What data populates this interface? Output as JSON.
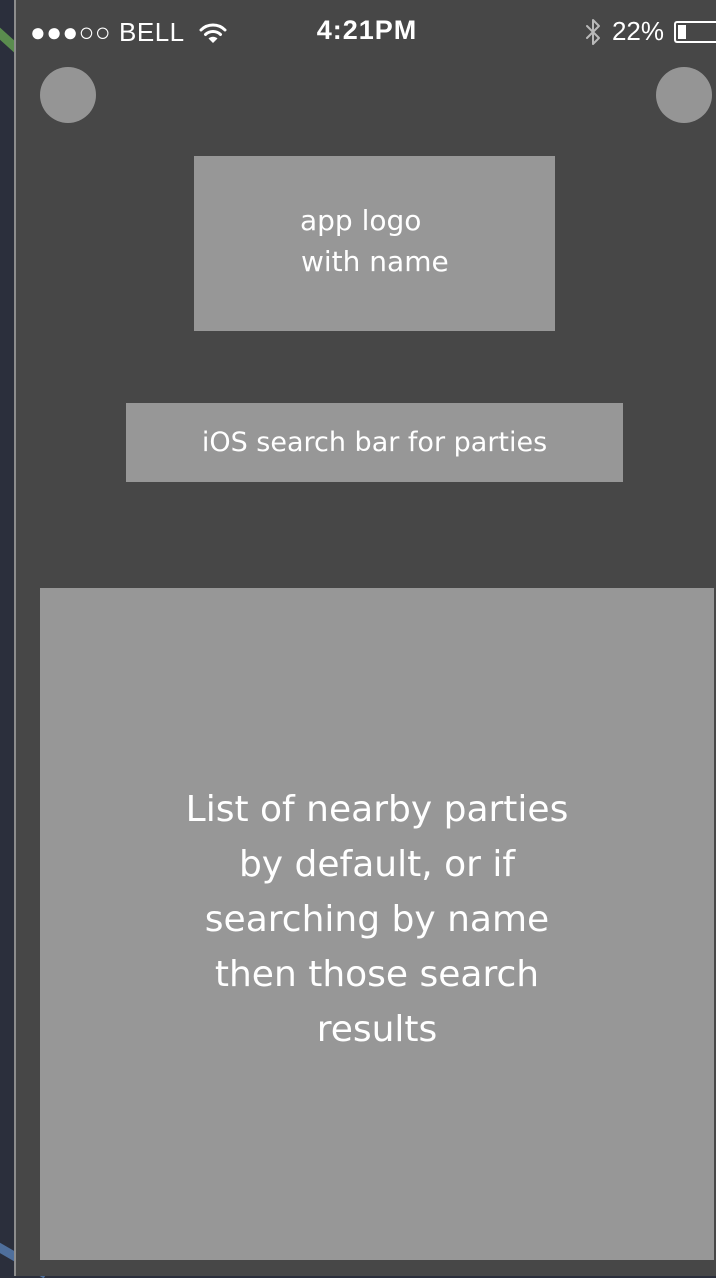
{
  "status_bar": {
    "signal": "●●●○○",
    "carrier": "BELL",
    "time": "4:21PM",
    "battery_text": "22%",
    "battery_level": 0.22
  },
  "logo_box": {
    "line1": "app logo",
    "line2": "with name"
  },
  "search_box": {
    "label": "iOS search bar for parties"
  },
  "list_box": {
    "lines": [
      "List of nearby parties",
      "by default, or if",
      "searching by name",
      "then those search",
      "results"
    ]
  },
  "colors": {
    "screen_background": "#474747",
    "placeholder_gray": "#979797",
    "backdrop": "#2b2f3c",
    "accent_green": "#5a8c4e",
    "accent_blue": "#4f6f9c"
  },
  "icons": {
    "wifi": "wifi-icon",
    "bluetooth": "bluetooth-icon",
    "battery": "battery-icon"
  }
}
